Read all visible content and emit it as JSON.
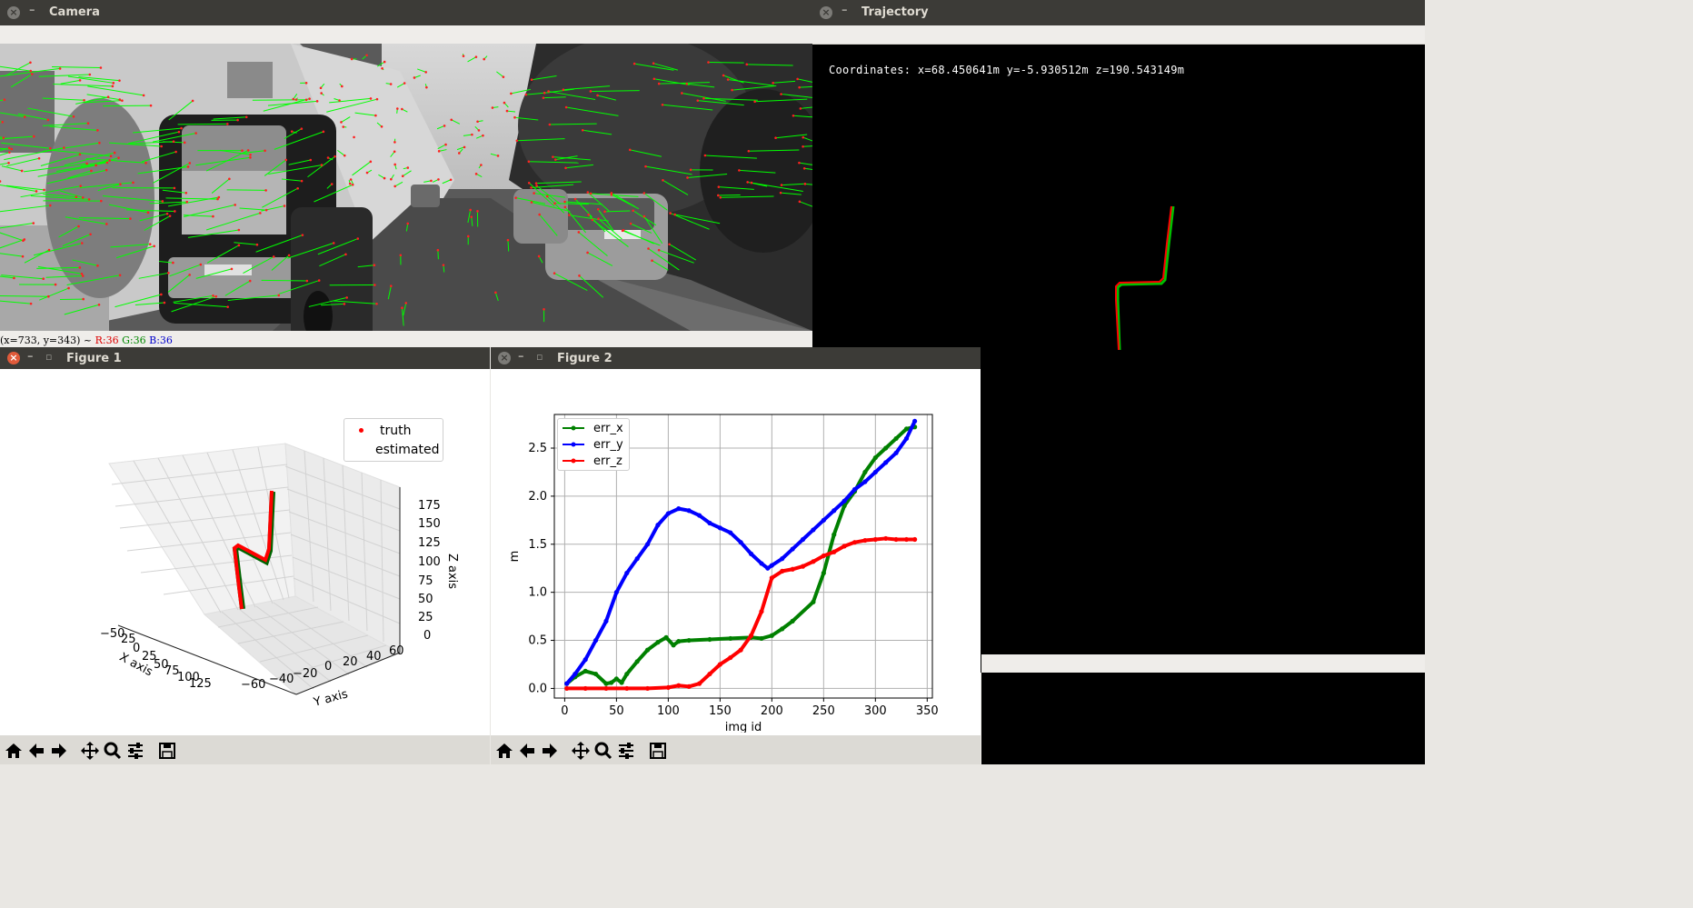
{
  "windows": {
    "camera": {
      "title": "Camera"
    },
    "trajectory": {
      "title": "Trajectory",
      "coordinates": "Coordinates: x=68.450641m y=-5.930512m z=190.543149m"
    },
    "figure1": {
      "title": "Figure 1"
    },
    "figure2": {
      "title": "Figure 2"
    }
  },
  "camera_status": {
    "pos": "(x=733, y=343) ~",
    "r": "R:36",
    "g": "G:36",
    "b": "B:36"
  },
  "window_controls": {
    "close": "×",
    "minimize": "–",
    "restore": "▫"
  },
  "toolbar_icons": [
    "home-icon",
    "back-arrow-icon",
    "forward-arrow-icon",
    "pan-icon",
    "zoom-icon",
    "configure-subplots-icon",
    "save-icon"
  ],
  "figure1_chart": {
    "type": "scatter",
    "legend": [
      "truth",
      "estimated"
    ],
    "xlabel": "X axis",
    "ylabel": "Y axis",
    "zlabel": "Z axis",
    "x_ticks": [
      "−50",
      "25",
      "0",
      "25",
      "50",
      "75",
      "100",
      "125"
    ],
    "y_ticks": [
      "−60",
      "−40",
      "−20",
      "0",
      "20",
      "40",
      "60"
    ],
    "z_ticks": [
      "175",
      "150",
      "125",
      "100",
      "75",
      "50",
      "25",
      "0"
    ],
    "colors": {
      "truth": "#ff0000",
      "estimated": "#008000"
    }
  },
  "chart_data": {
    "type": "line",
    "title": "",
    "xlabel": "img id",
    "ylabel": "m",
    "xlim": [
      -10,
      355
    ],
    "ylim": [
      -0.1,
      2.85
    ],
    "x_ticks": [
      "0",
      "50",
      "100",
      "150",
      "200",
      "250",
      "300",
      "350"
    ],
    "y_ticks": [
      "0.0",
      "0.5",
      "1.0",
      "1.5",
      "2.0",
      "2.5"
    ],
    "x_tick_values": [
      0,
      50,
      100,
      150,
      200,
      250,
      300,
      350
    ],
    "y_tick_values": [
      0,
      0.5,
      1.0,
      1.5,
      2.0,
      2.5
    ],
    "grid": true,
    "legend_placement": "upper-left",
    "series": [
      {
        "name": "err_x",
        "color": "#008000",
        "x": [
          2,
          10,
          20,
          30,
          40,
          45,
          50,
          55,
          60,
          70,
          80,
          90,
          98,
          105,
          110,
          120,
          140,
          160,
          180,
          190,
          200,
          210,
          220,
          240,
          250,
          260,
          270,
          280,
          290,
          300,
          310,
          320,
          330,
          338
        ],
        "y": [
          0.05,
          0.12,
          0.18,
          0.15,
          0.05,
          0.06,
          0.1,
          0.06,
          0.15,
          0.28,
          0.4,
          0.48,
          0.53,
          0.45,
          0.49,
          0.5,
          0.51,
          0.52,
          0.53,
          0.52,
          0.55,
          0.62,
          0.7,
          0.9,
          1.2,
          1.6,
          1.9,
          2.05,
          2.25,
          2.4,
          2.5,
          2.6,
          2.7,
          2.72
        ]
      },
      {
        "name": "err_y",
        "color": "#0000ff",
        "x": [
          2,
          10,
          20,
          30,
          40,
          50,
          60,
          70,
          80,
          90,
          100,
          110,
          120,
          130,
          140,
          150,
          160,
          170,
          180,
          190,
          196,
          200,
          210,
          220,
          230,
          240,
          250,
          260,
          270,
          280,
          290,
          300,
          310,
          320,
          330,
          338
        ],
        "y": [
          0.05,
          0.15,
          0.3,
          0.5,
          0.7,
          1.0,
          1.2,
          1.35,
          1.5,
          1.7,
          1.82,
          1.87,
          1.85,
          1.8,
          1.72,
          1.67,
          1.62,
          1.52,
          1.4,
          1.3,
          1.25,
          1.28,
          1.35,
          1.45,
          1.55,
          1.65,
          1.75,
          1.85,
          1.95,
          2.07,
          2.15,
          2.25,
          2.35,
          2.45,
          2.6,
          2.78
        ]
      },
      {
        "name": "err_z",
        "color": "#ff0000",
        "x": [
          2,
          20,
          40,
          60,
          80,
          100,
          110,
          120,
          130,
          140,
          150,
          160,
          170,
          180,
          190,
          200,
          210,
          220,
          230,
          240,
          250,
          260,
          270,
          280,
          290,
          300,
          310,
          320,
          330,
          338
        ],
        "y": [
          0.0,
          0.0,
          0.0,
          0.0,
          0.0,
          0.01,
          0.03,
          0.02,
          0.05,
          0.15,
          0.25,
          0.32,
          0.4,
          0.55,
          0.8,
          1.15,
          1.22,
          1.24,
          1.27,
          1.32,
          1.38,
          1.42,
          1.48,
          1.52,
          1.54,
          1.55,
          1.56,
          1.55,
          1.55,
          1.55
        ]
      }
    ]
  }
}
